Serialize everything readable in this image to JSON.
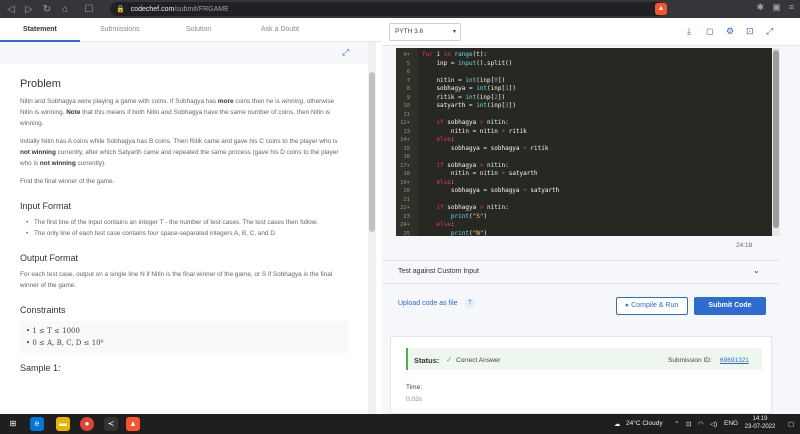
{
  "browser": {
    "url_domain": "codechef.com",
    "url_path": "/submit/FRGAME"
  },
  "tabs": [
    {
      "label": "Statement",
      "active": true
    },
    {
      "label": "Submissions",
      "active": false
    },
    {
      "label": "Solution",
      "active": false
    },
    {
      "label": "Ask a Doubt",
      "active": false
    }
  ],
  "problem": {
    "title": "Problem",
    "p1_a": "Nitin and Sobhagya were playing a game with coins. If Sobhagya has ",
    "p1_b": "more",
    "p1_c": " coins then he is ",
    "p1_d": "winning",
    "p1_e": ", otherwise Nitin is winning. ",
    "p1_f": "Note",
    "p1_g": " that this means if both Nitin and Sobhagya have the same number of coins, then Nitin is winning.",
    "p2_a": "Initially Nitin has A coins while Sobhagya has B coins. Then Ritik came and gave his C coins to the player who is ",
    "p2_b": "not winning",
    "p2_c": " currently, after which Satyarth came and repeated the same process (gave his D coins to the player who is ",
    "p2_d": "not winning",
    "p2_e": " currently).",
    "p3": "Find the final winner of the game.",
    "input_heading": "Input Format",
    "input_items": [
      "The first line of the input contains an integer T - the number of test cases. The test cases then follow.",
      "The only line of each test case contains four space-separated integers A, B, C, and D."
    ],
    "output_heading": "Output Format",
    "output_text": "For each test case, output on a single line N if Nitin is the final winner of the game, or S if Sobhagya is the final winner of the game.",
    "constraints_heading": "Constraints",
    "constraints": [
      "1 ≤ T ≤ 1000",
      "0 ≤ A, B, C, D ≤ 10⁶"
    ],
    "sample_heading": "Sample 1:"
  },
  "editor": {
    "language": "PYTH 3.6",
    "cursor_position": "24:18",
    "lines": [
      {
        "num": "4",
        "fold": true,
        "code": [
          [
            "kw",
            "for "
          ],
          [
            "txt",
            "i "
          ],
          [
            "kw",
            "in "
          ],
          [
            "fn",
            "range"
          ],
          [
            "txt",
            "(t):"
          ]
        ]
      },
      {
        "num": "5",
        "code": [
          [
            "txt",
            "    inp = "
          ],
          [
            "fn",
            "input"
          ],
          [
            "txt",
            "().split()"
          ]
        ]
      },
      {
        "num": "6",
        "code": [
          [
            "txt",
            ""
          ]
        ]
      },
      {
        "num": "7",
        "code": [
          [
            "txt",
            "    nitin = "
          ],
          [
            "fn",
            "int"
          ],
          [
            "txt",
            "(inp["
          ],
          [
            "num",
            "0"
          ],
          [
            "txt",
            "])"
          ]
        ]
      },
      {
        "num": "8",
        "code": [
          [
            "txt",
            "    sobhagya = "
          ],
          [
            "fn",
            "int"
          ],
          [
            "txt",
            "(inp["
          ],
          [
            "num",
            "1"
          ],
          [
            "txt",
            "])"
          ]
        ]
      },
      {
        "num": "9",
        "code": [
          [
            "txt",
            "    ritik = "
          ],
          [
            "fn",
            "int"
          ],
          [
            "txt",
            "(inp["
          ],
          [
            "num",
            "2"
          ],
          [
            "txt",
            "])"
          ]
        ]
      },
      {
        "num": "10",
        "code": [
          [
            "txt",
            "    satyarth = "
          ],
          [
            "fn",
            "int"
          ],
          [
            "txt",
            "(inp["
          ],
          [
            "num",
            "3"
          ],
          [
            "txt",
            "])"
          ]
        ]
      },
      {
        "num": "11",
        "code": [
          [
            "txt",
            ""
          ]
        ]
      },
      {
        "num": "12",
        "fold": true,
        "code": [
          [
            "txt",
            "    "
          ],
          [
            "kw",
            "if "
          ],
          [
            "txt",
            "sobhagya "
          ],
          [
            "kw",
            "> "
          ],
          [
            "txt",
            "nitin:"
          ]
        ]
      },
      {
        "num": "13",
        "code": [
          [
            "txt",
            "        nitin = nitin "
          ],
          [
            "kw",
            "+ "
          ],
          [
            "txt",
            "ritik"
          ]
        ]
      },
      {
        "num": "14",
        "fold": true,
        "code": [
          [
            "txt",
            "    "
          ],
          [
            "kw",
            "else"
          ],
          [
            "txt",
            ":"
          ]
        ]
      },
      {
        "num": "15",
        "code": [
          [
            "txt",
            "        sobhagya = sobhagya "
          ],
          [
            "kw",
            "+ "
          ],
          [
            "txt",
            "ritik"
          ]
        ]
      },
      {
        "num": "16",
        "code": [
          [
            "txt",
            ""
          ]
        ]
      },
      {
        "num": "17",
        "fold": true,
        "code": [
          [
            "txt",
            "    "
          ],
          [
            "kw",
            "if "
          ],
          [
            "txt",
            "sobhagya "
          ],
          [
            "kw",
            "> "
          ],
          [
            "txt",
            "nitin:"
          ]
        ]
      },
      {
        "num": "18",
        "code": [
          [
            "txt",
            "        nitin = nitin "
          ],
          [
            "kw",
            "+ "
          ],
          [
            "txt",
            "satyarth"
          ]
        ]
      },
      {
        "num": "19",
        "fold": true,
        "code": [
          [
            "txt",
            "    "
          ],
          [
            "kw",
            "else"
          ],
          [
            "txt",
            ":"
          ]
        ]
      },
      {
        "num": "20",
        "code": [
          [
            "txt",
            "        sobhagya = sobhagya "
          ],
          [
            "kw",
            "+ "
          ],
          [
            "txt",
            "satyarth"
          ]
        ]
      },
      {
        "num": "21",
        "code": [
          [
            "txt",
            ""
          ]
        ]
      },
      {
        "num": "22",
        "fold": true,
        "code": [
          [
            "txt",
            "    "
          ],
          [
            "kw",
            "if "
          ],
          [
            "txt",
            "sobhagya "
          ],
          [
            "kw",
            "> "
          ],
          [
            "txt",
            "nitin:"
          ]
        ]
      },
      {
        "num": "23",
        "code": [
          [
            "txt",
            "        "
          ],
          [
            "fn",
            "print"
          ],
          [
            "txt",
            "("
          ],
          [
            "str",
            "\"S\""
          ],
          [
            "txt",
            ")"
          ]
        ]
      },
      {
        "num": "24",
        "fold": true,
        "code": [
          [
            "txt",
            "    "
          ],
          [
            "kw",
            "else"
          ],
          [
            "txt",
            ":"
          ]
        ]
      },
      {
        "num": "25",
        "code": [
          [
            "txt",
            "        "
          ],
          [
            "fn",
            "print"
          ],
          [
            "txt",
            "("
          ],
          [
            "str",
            "\"N\""
          ],
          [
            "txt",
            ")"
          ]
        ]
      }
    ]
  },
  "custom": {
    "label": "Test against Custom Input"
  },
  "actions": {
    "upload_label": "Upload code as file",
    "compile_label": "▸ Compile & Run",
    "submit_label": "Submit Code"
  },
  "result": {
    "status_label": "Status:",
    "status_value": "Correct Answer",
    "submission_label": "Submission ID:",
    "submission_id": "69691321",
    "time_label": "Time:",
    "time_value": "0.03s"
  },
  "taskbar": {
    "weather": "24°C  Cloudy",
    "lang": "ENG",
    "time": "14:19",
    "date": "23-07-2022"
  },
  "colors": {
    "accent": "#2e6cd1",
    "success": "#4caf50",
    "editor_bg": "#272822"
  }
}
